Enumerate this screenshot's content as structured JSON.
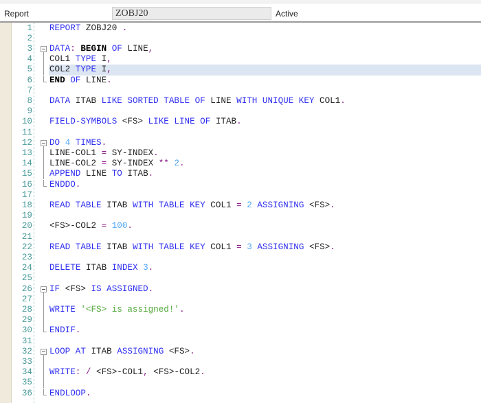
{
  "header": {
    "label": "Report",
    "program_name": "ZOBJ20",
    "status": "Active"
  },
  "code": {
    "highlighted_line": 5,
    "lines": [
      {
        "n": "1",
        "fold": "",
        "tokens": [
          {
            "c": "k",
            "t": "REPORT"
          },
          {
            "c": "i",
            "t": " ZOBJ20 "
          },
          {
            "c": "p",
            "t": "."
          }
        ]
      },
      {
        "n": "2",
        "fold": "",
        "tokens": []
      },
      {
        "n": "3",
        "fold": "start",
        "tokens": [
          {
            "c": "k",
            "t": "DATA"
          },
          {
            "c": "p",
            "t": ":"
          },
          {
            "c": "i",
            "t": " "
          },
          {
            "c": "b",
            "t": "BEGIN"
          },
          {
            "c": "i",
            "t": " "
          },
          {
            "c": "k",
            "t": "OF"
          },
          {
            "c": "i",
            "t": " LINE"
          },
          {
            "c": "p",
            "t": ","
          }
        ]
      },
      {
        "n": "4",
        "fold": "mid",
        "tokens": [
          {
            "c": "i",
            "t": "COL1 "
          },
          {
            "c": "k",
            "t": "TYPE"
          },
          {
            "c": "i",
            "t": " I"
          },
          {
            "c": "p",
            "t": ","
          }
        ]
      },
      {
        "n": "5",
        "fold": "mid",
        "tokens": [
          {
            "c": "i",
            "t": "COL2 "
          },
          {
            "c": "k",
            "t": "TYPE"
          },
          {
            "c": "i",
            "t": " I"
          },
          {
            "c": "p",
            "t": ","
          }
        ]
      },
      {
        "n": "6",
        "fold": "end",
        "tokens": [
          {
            "c": "b",
            "t": "END"
          },
          {
            "c": "i",
            "t": " "
          },
          {
            "c": "k",
            "t": "OF"
          },
          {
            "c": "i",
            "t": " LINE"
          },
          {
            "c": "p",
            "t": "."
          }
        ]
      },
      {
        "n": "7",
        "fold": "",
        "tokens": []
      },
      {
        "n": "8",
        "fold": "",
        "tokens": [
          {
            "c": "k",
            "t": "DATA"
          },
          {
            "c": "i",
            "t": " ITAB "
          },
          {
            "c": "k",
            "t": "LIKE SORTED TABLE OF"
          },
          {
            "c": "i",
            "t": " LINE "
          },
          {
            "c": "k",
            "t": "WITH UNIQUE KEY"
          },
          {
            "c": "i",
            "t": " COL1"
          },
          {
            "c": "p",
            "t": "."
          }
        ]
      },
      {
        "n": "9",
        "fold": "",
        "tokens": []
      },
      {
        "n": "10",
        "fold": "",
        "tokens": [
          {
            "c": "k",
            "t": "FIELD-SYMBOLS"
          },
          {
            "c": "i",
            "t": " <FS> "
          },
          {
            "c": "k",
            "t": "LIKE LINE OF"
          },
          {
            "c": "i",
            "t": " ITAB"
          },
          {
            "c": "p",
            "t": "."
          }
        ]
      },
      {
        "n": "11",
        "fold": "",
        "tokens": []
      },
      {
        "n": "12",
        "fold": "start",
        "tokens": [
          {
            "c": "k",
            "t": "DO"
          },
          {
            "c": "i",
            "t": " "
          },
          {
            "c": "n",
            "t": "4"
          },
          {
            "c": "i",
            "t": " "
          },
          {
            "c": "k",
            "t": "TIMES"
          },
          {
            "c": "p",
            "t": "."
          }
        ]
      },
      {
        "n": "13",
        "fold": "mid",
        "tokens": [
          {
            "c": "i",
            "t": "LINE-COL1 "
          },
          {
            "c": "p",
            "t": "="
          },
          {
            "c": "i",
            "t": " SY-INDEX"
          },
          {
            "c": "p",
            "t": "."
          }
        ]
      },
      {
        "n": "14",
        "fold": "mid",
        "tokens": [
          {
            "c": "i",
            "t": "LINE-COL2 "
          },
          {
            "c": "p",
            "t": "="
          },
          {
            "c": "i",
            "t": " SY-INDEX "
          },
          {
            "c": "p",
            "t": "**"
          },
          {
            "c": "i",
            "t": " "
          },
          {
            "c": "n",
            "t": "2"
          },
          {
            "c": "p",
            "t": "."
          }
        ]
      },
      {
        "n": "15",
        "fold": "mid",
        "tokens": [
          {
            "c": "k",
            "t": "APPEND"
          },
          {
            "c": "i",
            "t": " LINE "
          },
          {
            "c": "k",
            "t": "TO"
          },
          {
            "c": "i",
            "t": " ITAB"
          },
          {
            "c": "p",
            "t": "."
          }
        ]
      },
      {
        "n": "16",
        "fold": "end",
        "tokens": [
          {
            "c": "k",
            "t": "ENDDO"
          },
          {
            "c": "p",
            "t": "."
          }
        ]
      },
      {
        "n": "17",
        "fold": "",
        "tokens": []
      },
      {
        "n": "18",
        "fold": "",
        "tokens": [
          {
            "c": "k",
            "t": "READ TABLE"
          },
          {
            "c": "i",
            "t": " ITAB "
          },
          {
            "c": "k",
            "t": "WITH TABLE KEY"
          },
          {
            "c": "i",
            "t": " COL1 "
          },
          {
            "c": "p",
            "t": "="
          },
          {
            "c": "i",
            "t": " "
          },
          {
            "c": "n",
            "t": "2"
          },
          {
            "c": "i",
            "t": " "
          },
          {
            "c": "k",
            "t": "ASSIGNING"
          },
          {
            "c": "i",
            "t": " <FS>"
          },
          {
            "c": "p",
            "t": "."
          }
        ]
      },
      {
        "n": "19",
        "fold": "",
        "tokens": []
      },
      {
        "n": "20",
        "fold": "",
        "tokens": [
          {
            "c": "i",
            "t": "<FS>-COL2 "
          },
          {
            "c": "p",
            "t": "="
          },
          {
            "c": "i",
            "t": " "
          },
          {
            "c": "n",
            "t": "100"
          },
          {
            "c": "p",
            "t": "."
          }
        ]
      },
      {
        "n": "21",
        "fold": "",
        "tokens": []
      },
      {
        "n": "22",
        "fold": "",
        "tokens": [
          {
            "c": "k",
            "t": "READ TABLE"
          },
          {
            "c": "i",
            "t": " ITAB "
          },
          {
            "c": "k",
            "t": "WITH TABLE KEY"
          },
          {
            "c": "i",
            "t": " COL1 "
          },
          {
            "c": "p",
            "t": "="
          },
          {
            "c": "i",
            "t": " "
          },
          {
            "c": "n",
            "t": "3"
          },
          {
            "c": "i",
            "t": " "
          },
          {
            "c": "k",
            "t": "ASSIGNING"
          },
          {
            "c": "i",
            "t": " <FS>"
          },
          {
            "c": "p",
            "t": "."
          }
        ]
      },
      {
        "n": "23",
        "fold": "",
        "tokens": []
      },
      {
        "n": "24",
        "fold": "",
        "tokens": [
          {
            "c": "k",
            "t": "DELETE"
          },
          {
            "c": "i",
            "t": " ITAB "
          },
          {
            "c": "k",
            "t": "INDEX"
          },
          {
            "c": "i",
            "t": " "
          },
          {
            "c": "n",
            "t": "3"
          },
          {
            "c": "p",
            "t": "."
          }
        ]
      },
      {
        "n": "25",
        "fold": "",
        "tokens": []
      },
      {
        "n": "26",
        "fold": "start",
        "tokens": [
          {
            "c": "k",
            "t": "IF"
          },
          {
            "c": "i",
            "t": " <FS> "
          },
          {
            "c": "k",
            "t": "IS ASSIGNED"
          },
          {
            "c": "p",
            "t": "."
          }
        ]
      },
      {
        "n": "27",
        "fold": "mid",
        "tokens": []
      },
      {
        "n": "28",
        "fold": "mid",
        "tokens": [
          {
            "c": "k",
            "t": "WRITE"
          },
          {
            "c": "i",
            "t": " "
          },
          {
            "c": "s",
            "t": "'<FS> is assigned!'"
          },
          {
            "c": "p",
            "t": "."
          }
        ]
      },
      {
        "n": "29",
        "fold": "mid",
        "tokens": []
      },
      {
        "n": "30",
        "fold": "end",
        "tokens": [
          {
            "c": "k",
            "t": "ENDIF"
          },
          {
            "c": "p",
            "t": "."
          }
        ]
      },
      {
        "n": "31",
        "fold": "",
        "tokens": []
      },
      {
        "n": "32",
        "fold": "start",
        "tokens": [
          {
            "c": "k",
            "t": "LOOP AT"
          },
          {
            "c": "i",
            "t": " ITAB "
          },
          {
            "c": "k",
            "t": "ASSIGNING"
          },
          {
            "c": "i",
            "t": " <FS>"
          },
          {
            "c": "p",
            "t": "."
          }
        ]
      },
      {
        "n": "33",
        "fold": "mid",
        "tokens": []
      },
      {
        "n": "34",
        "fold": "mid",
        "tokens": [
          {
            "c": "k",
            "t": "WRITE"
          },
          {
            "c": "p",
            "t": ":"
          },
          {
            "c": "i",
            "t": " "
          },
          {
            "c": "p",
            "t": "/"
          },
          {
            "c": "i",
            "t": " <FS>-COL1"
          },
          {
            "c": "p",
            "t": ","
          },
          {
            "c": "i",
            "t": " <FS>-COL2"
          },
          {
            "c": "p",
            "t": "."
          }
        ]
      },
      {
        "n": "35",
        "fold": "mid",
        "tokens": []
      },
      {
        "n": "36",
        "fold": "end",
        "tokens": [
          {
            "c": "k",
            "t": "ENDLOOP"
          },
          {
            "c": "p",
            "t": "."
          }
        ]
      }
    ]
  }
}
